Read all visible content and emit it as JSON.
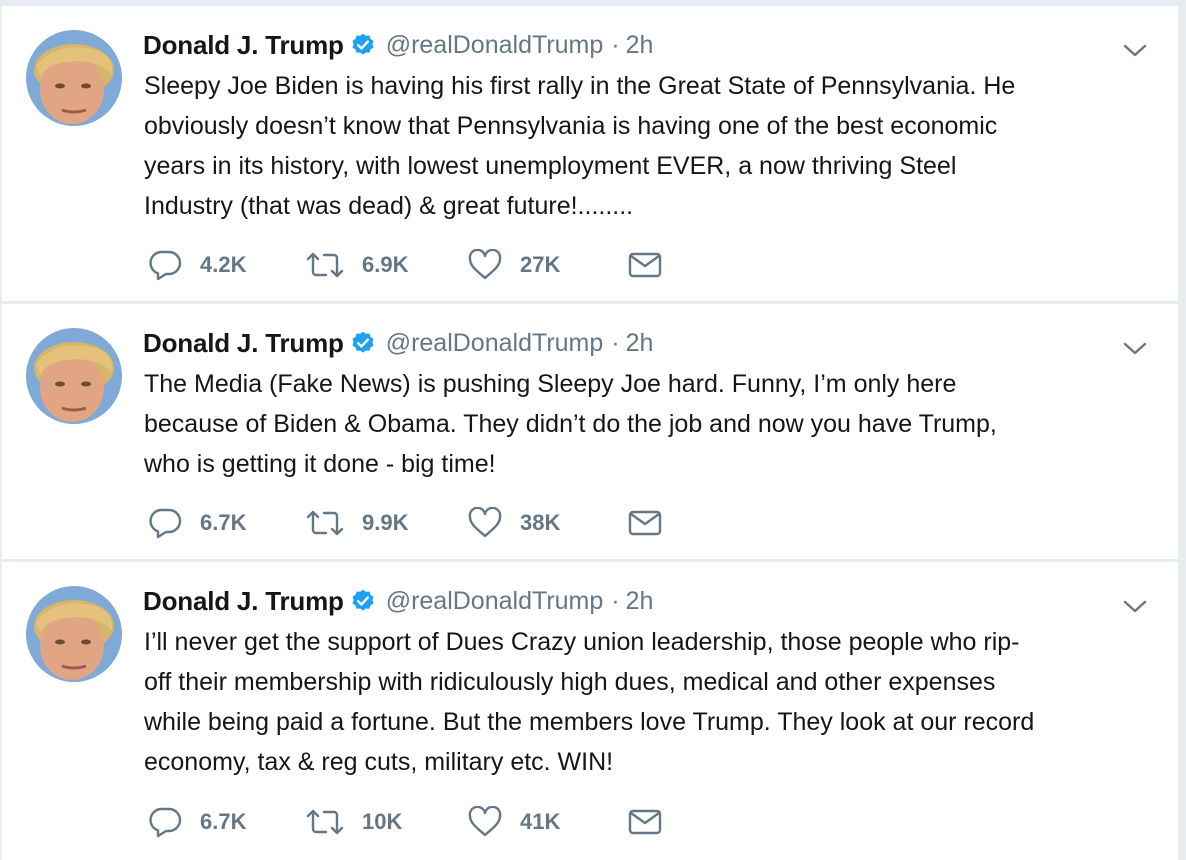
{
  "icons": {
    "verified": "verified-badge-icon",
    "caret": "chevron-down-icon",
    "reply": "reply-icon",
    "retweet": "retweet-icon",
    "like": "heart-icon",
    "dm": "envelope-icon"
  },
  "colors": {
    "text": "#14171a",
    "secondary": "#657786",
    "verified": "#1da1f2",
    "divider": "#e6ecf0"
  },
  "tweets": [
    {
      "name": "Donald J. Trump",
      "handle": "@realDonaldTrump",
      "separator": "·",
      "time": "2h",
      "text": "Sleepy Joe Biden is having his first rally in the Great State of Pennsylvania. He\nobviously doesn’t know that Pennsylvania is having one of the best economic\nyears in its history, with lowest unemployment EVER, a now thriving Steel\nIndustry (that was dead) & great future!........",
      "replies": "4.2K",
      "retweets": "6.9K",
      "likes": "27K"
    },
    {
      "name": "Donald J. Trump",
      "handle": "@realDonaldTrump",
      "separator": "·",
      "time": "2h",
      "text": "The Media (Fake News) is pushing Sleepy Joe hard. Funny, I’m only here\nbecause of Biden & Obama. They didn’t do the job and now you have Trump,\nwho is getting it done - big time!",
      "replies": "6.7K",
      "retweets": "9.9K",
      "likes": "38K"
    },
    {
      "name": "Donald J. Trump",
      "handle": "@realDonaldTrump",
      "separator": "·",
      "time": "2h",
      "text": "I’ll never get the support of Dues Crazy union leadership, those people who rip-\noff their membership with ridiculously high dues, medical and other expenses\nwhile being paid a fortune. But the members love Trump. They look at our record\neconomy, tax & reg cuts, military etc. WIN!",
      "replies": "6.7K",
      "retweets": "10K",
      "likes": "41K"
    }
  ]
}
